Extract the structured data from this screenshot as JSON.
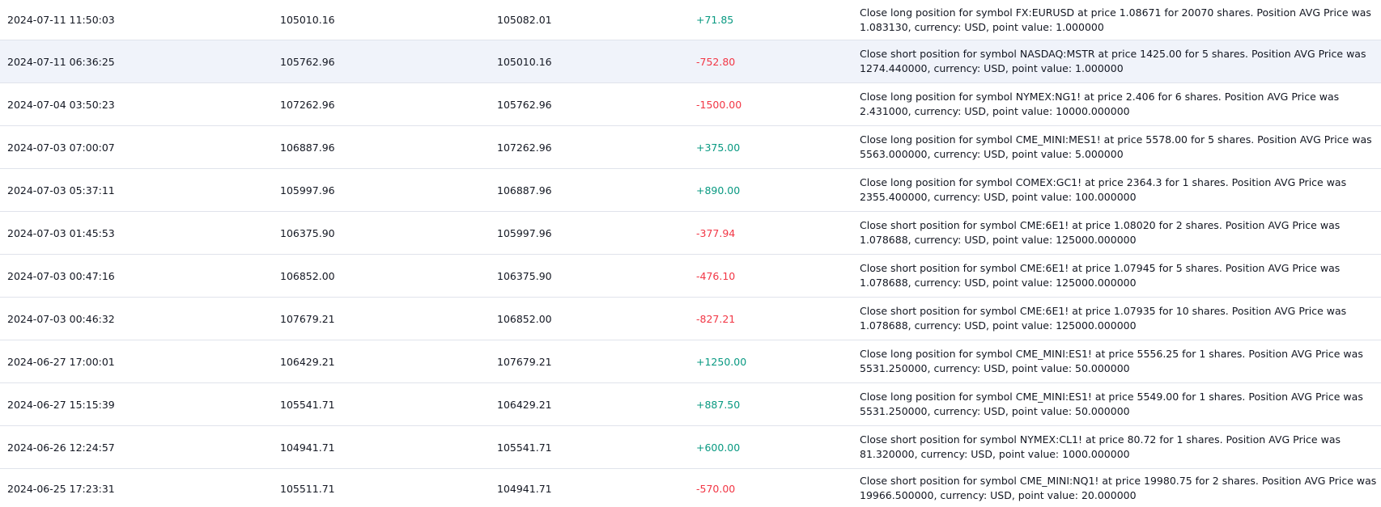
{
  "rows": [
    {
      "time": "2024-07-11 11:50:03",
      "balance_before": "105010.16",
      "balance_after": "105082.01",
      "pnl": "+71.85",
      "pnl_sign": "positive",
      "description": "Close long position for symbol FX:EURUSD at price 1.08671 for 20070 shares. Position AVG Price was 1.083130, currency: USD, point value: 1.000000"
    },
    {
      "time": "2024-07-11 06:36:25",
      "balance_before": "105762.96",
      "balance_after": "105010.16",
      "pnl": "-752.80",
      "pnl_sign": "negative",
      "description": "Close short position for symbol NASDAQ:MSTR at price 1425.00 for 5 shares. Position AVG Price was 1274.440000, currency: USD, point value: 1.000000"
    },
    {
      "time": "2024-07-04 03:50:23",
      "balance_before": "107262.96",
      "balance_after": "105762.96",
      "pnl": "-1500.00",
      "pnl_sign": "negative",
      "description": "Close long position for symbol NYMEX:NG1! at price 2.406 for 6 shares. Position AVG Price was 2.431000, currency: USD, point value: 10000.000000"
    },
    {
      "time": "2024-07-03 07:00:07",
      "balance_before": "106887.96",
      "balance_after": "107262.96",
      "pnl": "+375.00",
      "pnl_sign": "positive",
      "description": "Close long position for symbol CME_MINI:MES1! at price 5578.00 for 5 shares. Position AVG Price was 5563.000000, currency: USD, point value: 5.000000"
    },
    {
      "time": "2024-07-03 05:37:11",
      "balance_before": "105997.96",
      "balance_after": "106887.96",
      "pnl": "+890.00",
      "pnl_sign": "positive",
      "description": "Close long position for symbol COMEX:GC1! at price 2364.3 for 1 shares. Position AVG Price was 2355.400000, currency: USD, point value: 100.000000"
    },
    {
      "time": "2024-07-03 01:45:53",
      "balance_before": "106375.90",
      "balance_after": "105997.96",
      "pnl": "-377.94",
      "pnl_sign": "negative",
      "description": "Close short position for symbol CME:6E1! at price 1.08020 for 2 shares. Position AVG Price was 1.078688, currency: USD, point value: 125000.000000"
    },
    {
      "time": "2024-07-03 00:47:16",
      "balance_before": "106852.00",
      "balance_after": "106375.90",
      "pnl": "-476.10",
      "pnl_sign": "negative",
      "description": "Close short position for symbol CME:6E1! at price 1.07945 for 5 shares. Position AVG Price was 1.078688, currency: USD, point value: 125000.000000"
    },
    {
      "time": "2024-07-03 00:46:32",
      "balance_before": "107679.21",
      "balance_after": "106852.00",
      "pnl": "-827.21",
      "pnl_sign": "negative",
      "description": "Close short position for symbol CME:6E1! at price 1.07935 for 10 shares. Position AVG Price was 1.078688, currency: USD, point value: 125000.000000"
    },
    {
      "time": "2024-06-27 17:00:01",
      "balance_before": "106429.21",
      "balance_after": "107679.21",
      "pnl": "+1250.00",
      "pnl_sign": "positive",
      "description": "Close long position for symbol CME_MINI:ES1! at price 5556.25 for 1 shares. Position AVG Price was 5531.250000, currency: USD, point value: 50.000000"
    },
    {
      "time": "2024-06-27 15:15:39",
      "balance_before": "105541.71",
      "balance_after": "106429.21",
      "pnl": "+887.50",
      "pnl_sign": "positive",
      "description": "Close long position for symbol CME_MINI:ES1! at price 5549.00 for 1 shares. Position AVG Price was 5531.250000, currency: USD, point value: 50.000000"
    },
    {
      "time": "2024-06-26 12:24:57",
      "balance_before": "104941.71",
      "balance_after": "105541.71",
      "pnl": "+600.00",
      "pnl_sign": "positive",
      "description": "Close short position for symbol NYMEX:CL1! at price 80.72 for 1 shares. Position AVG Price was 81.320000, currency: USD, point value: 1000.000000"
    },
    {
      "time": "2024-06-25 17:23:31",
      "balance_before": "105511.71",
      "balance_after": "104941.71",
      "pnl": "-570.00",
      "pnl_sign": "negative",
      "description": "Close short position for symbol CME_MINI:NQ1! at price 19980.75 for 2 shares. Position AVG Price was 19966.500000, currency: USD, point value: 20.000000"
    }
  ],
  "colors": {
    "positive": "#089981",
    "negative": "#f23645",
    "highlight_row_bg": "#f0f3fa",
    "row_divider": "#e0e3eb",
    "text": "#131722"
  }
}
